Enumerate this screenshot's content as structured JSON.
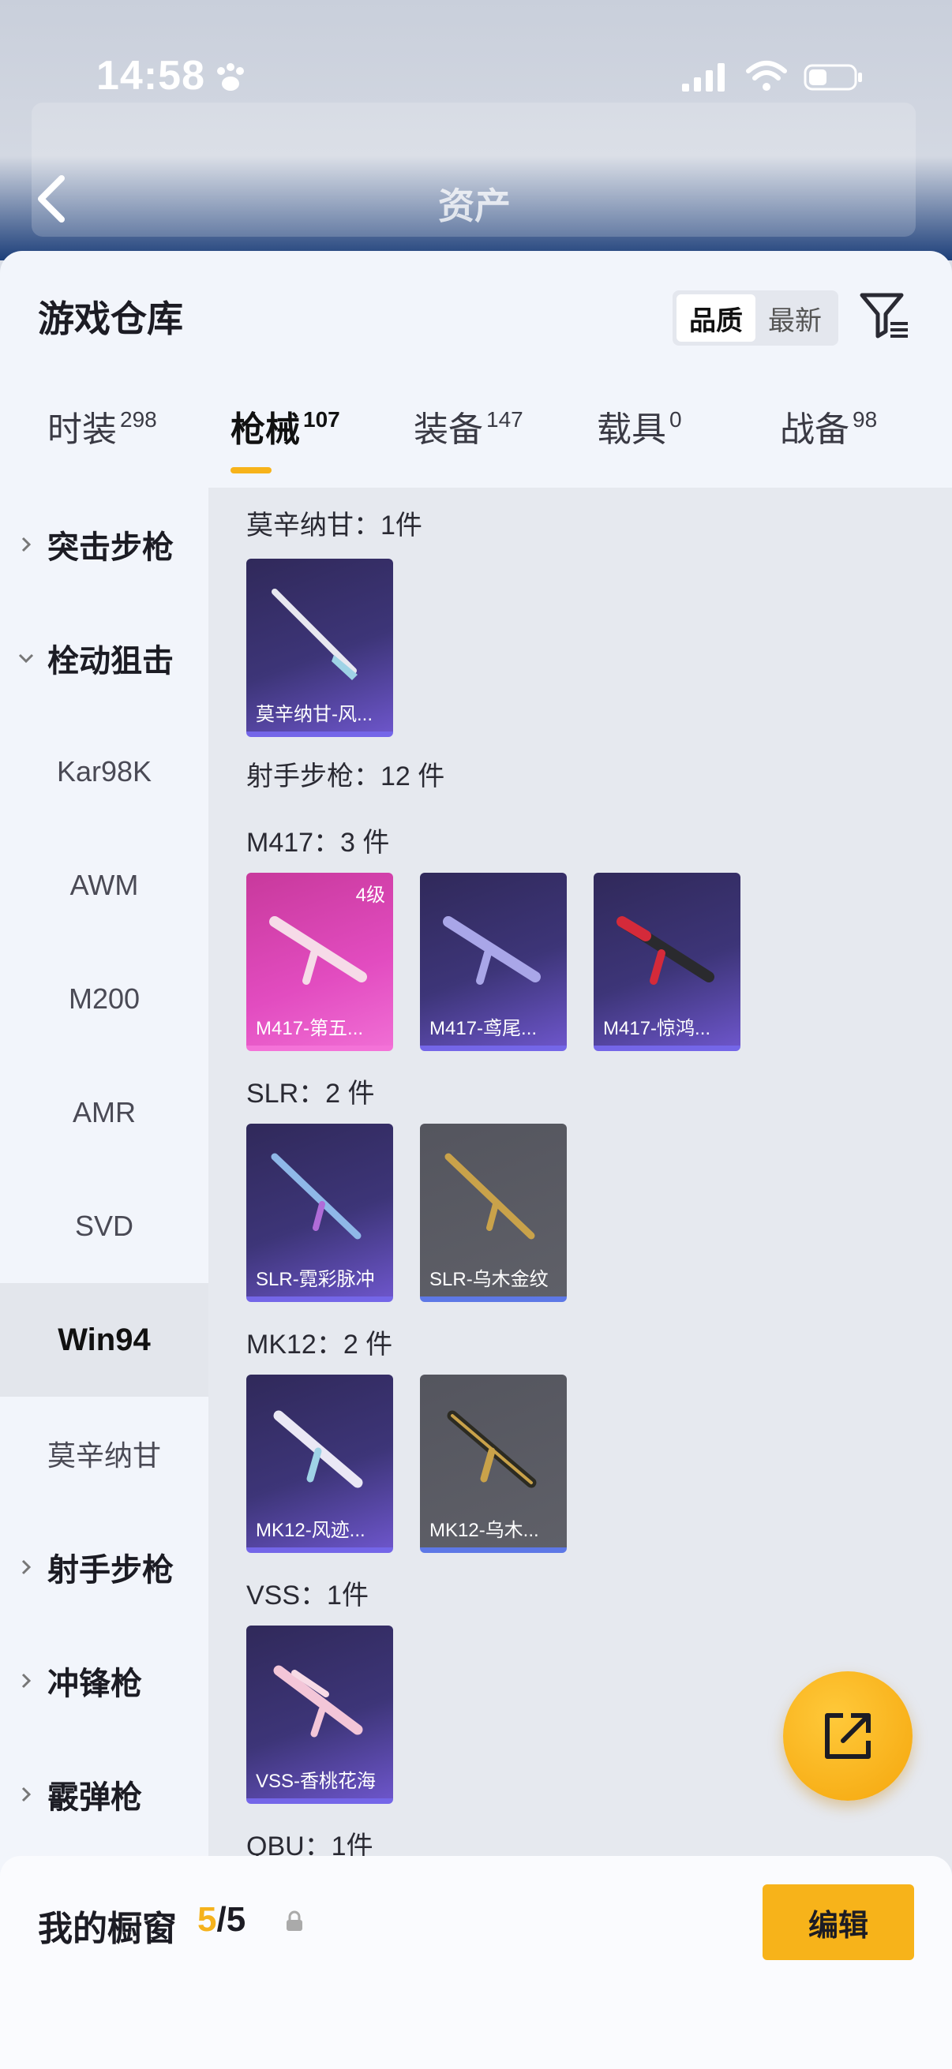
{
  "status_bar": {
    "time": "14:58"
  },
  "header": {
    "title": "资产"
  },
  "sheet": {
    "title": "游戏仓库",
    "sort_options": [
      "品质",
      "最新"
    ],
    "sort_selected": "品质"
  },
  "tabs": [
    {
      "label": "时装",
      "count": "298"
    },
    {
      "label": "枪械",
      "count": "107"
    },
    {
      "label": "装备",
      "count": "147"
    },
    {
      "label": "载具",
      "count": "0"
    },
    {
      "label": "战备",
      "count": "98"
    }
  ],
  "sidebar": {
    "cat_assault": "突击步枪",
    "cat_sniper": "栓动狙击",
    "sub_kar98k": "Kar98K",
    "sub_awm": "AWM",
    "sub_m200": "M200",
    "sub_amr": "AMR",
    "sub_svd": "SVD",
    "sub_win94": "Win94",
    "sub_mosin": "莫辛纳甘",
    "cat_marksman": "射手步枪",
    "cat_smg": "冲锋枪",
    "cat_shotgun": "霰弹枪"
  },
  "content": {
    "mosin_label": "莫辛纳甘：1件",
    "mosin_item": "莫辛纳甘-风...",
    "marksman_label": "射手步枪：12 件",
    "m417_label": "M417：3 件",
    "m417_items": [
      "M417-第五...",
      "M417-鸢尾...",
      "M417-惊鸿..."
    ],
    "m417_badge": "4级",
    "slr_label": "SLR：2 件",
    "slr_items": [
      "SLR-霓彩脉冲",
      "SLR-乌木金纹"
    ],
    "mk12_label": "MK12：2 件",
    "mk12_items": [
      "MK12-风迹...",
      "MK12-乌木..."
    ],
    "vss_label": "VSS：1件",
    "vss_item": "VSS-香桃花海",
    "qbu_label": "QBU：1件"
  },
  "bottom": {
    "showcase_label": "我的橱窗",
    "showcase_current": "5",
    "showcase_total": "/5",
    "edit_label": "编辑"
  },
  "colors": {
    "accent": "#f7b31a",
    "rare_purple": "#7466e8",
    "rare_pink": "#f472d8"
  }
}
